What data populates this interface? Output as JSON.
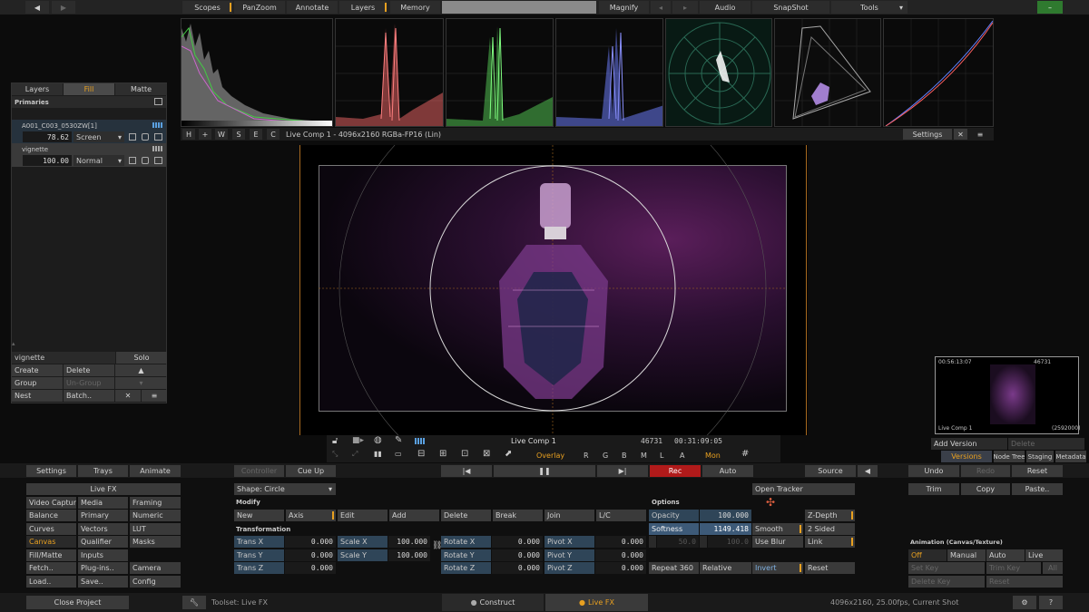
{
  "topbar": {
    "items": [
      "Scopes",
      "PanZoom",
      "Annotate",
      "Layers",
      "Memory",
      "Magnify",
      "Audio",
      "SnapShot",
      "Tools"
    ]
  },
  "scopes": {
    "bar_buttons": [
      "H",
      "+",
      "W",
      "S",
      "E",
      "C"
    ],
    "title": "Live Comp 1 - 4096x2160 RGBa-FP16 (Lin)",
    "settings": "Settings"
  },
  "leftpanel": {
    "tabs": [
      "Layers",
      "Fill",
      "Matte"
    ],
    "section": "Primaries",
    "layer1": {
      "name": "A001_C003_0530ZW[1]",
      "value": "78.62",
      "mode": "Screen"
    },
    "layer2": {
      "name": "vignette",
      "value": "100.00",
      "mode": "Normal"
    },
    "footer_name": "vignette",
    "solo": "Solo",
    "buttons": [
      "Create",
      "Delete",
      "Group",
      "Un-Group",
      "Nest",
      "Batch.."
    ]
  },
  "viewer": {
    "name": "Live Comp 1",
    "frame": "46731",
    "timecode": "00:31:09:05",
    "tools": [
      "Overlay",
      "R",
      "G",
      "B",
      "M",
      "L",
      "A",
      "Mon"
    ]
  },
  "preview": {
    "timecode": "00:56:13:07",
    "frame": "46731",
    "name": "Live Comp 1",
    "count": "(2592000)"
  },
  "versions": {
    "add": "Add Version",
    "delete": "Delete",
    "tabs": [
      "Versions",
      "Node Tree",
      "Staging",
      "Metadata"
    ]
  },
  "playbar": {
    "left": [
      "Settings",
      "Trays",
      "Animate"
    ],
    "controller": "Controller",
    "cueup": "Cue Up",
    "rec": "Rec",
    "auto": "Auto",
    "source": "Source",
    "undo": "Undo",
    "redo": "Redo",
    "reset": "Reset"
  },
  "menu": {
    "title": "Live FX",
    "col1": [
      "Video Capture",
      "Balance",
      "Curves",
      "Canvas",
      "Fill/Matte",
      "Fetch..",
      "Load.."
    ],
    "col2": [
      "Media",
      "Primary",
      "Vectors",
      "Qualifier",
      "Inputs",
      "Plug-ins..",
      "Save.."
    ],
    "col3": [
      "Framing",
      "Numeric",
      "LUT",
      "Masks",
      "",
      "Camera",
      "Config"
    ]
  },
  "shape": {
    "select": "Shape: Circle",
    "modify": "Modify",
    "modify_buttons": [
      "New",
      "Axis",
      "Edit",
      "Add",
      "Delete",
      "Break",
      "Join",
      "L/C"
    ],
    "transformation": "Transformation",
    "trans": [
      {
        "label": "Trans X",
        "value": "0.000"
      },
      {
        "label": "Trans Y",
        "value": "0.000"
      },
      {
        "label": "Trans Z",
        "value": "0.000"
      }
    ],
    "scale": [
      {
        "label": "Scale X",
        "value": "100.000"
      },
      {
        "label": "Scale Y",
        "value": "100.000"
      }
    ],
    "rotate": [
      {
        "label": "Rotate X",
        "value": "0.000"
      },
      {
        "label": "Rotate Y",
        "value": "0.000"
      },
      {
        "label": "Rotate Z",
        "value": "0.000"
      }
    ],
    "pivot": [
      {
        "label": "Pivot X",
        "value": "0.000"
      },
      {
        "label": "Pivot Y",
        "value": "0.000"
      },
      {
        "label": "Pivot Z",
        "value": "0.000"
      }
    ]
  },
  "options": {
    "title": "Options",
    "opacity_label": "Opacity",
    "opacity": "100.000",
    "softness_label": "Softness",
    "softness": "1149.418",
    "blur_a": "50.0",
    "blur_b": "100.0",
    "open_tracker": "Open Tracker",
    "zdepth": "Z-Depth",
    "smooth": "Smooth",
    "two_sided": "2 Sided",
    "use_blur": "Use Blur",
    "link": "Link",
    "repeat": "Repeat 360",
    "relative": "Relative",
    "invert": "Invert",
    "reset": "Reset"
  },
  "right": {
    "trim": "Trim",
    "copy": "Copy",
    "paste": "Paste..",
    "anim_title": "Animation (Canvas/Texture)",
    "anim": [
      "Off",
      "Manual",
      "Auto",
      "Live"
    ],
    "set_key": "Set Key",
    "trim_key": "Trim Key",
    "all": "All",
    "delete_key": "Delete Key",
    "reset": "Reset"
  },
  "status": {
    "close": "Close Project",
    "toolset": "Toolset: Live FX",
    "construct": "Construct",
    "livefx": "Live FX",
    "info": "4096x2160, 25.00fps, Current Shot"
  }
}
